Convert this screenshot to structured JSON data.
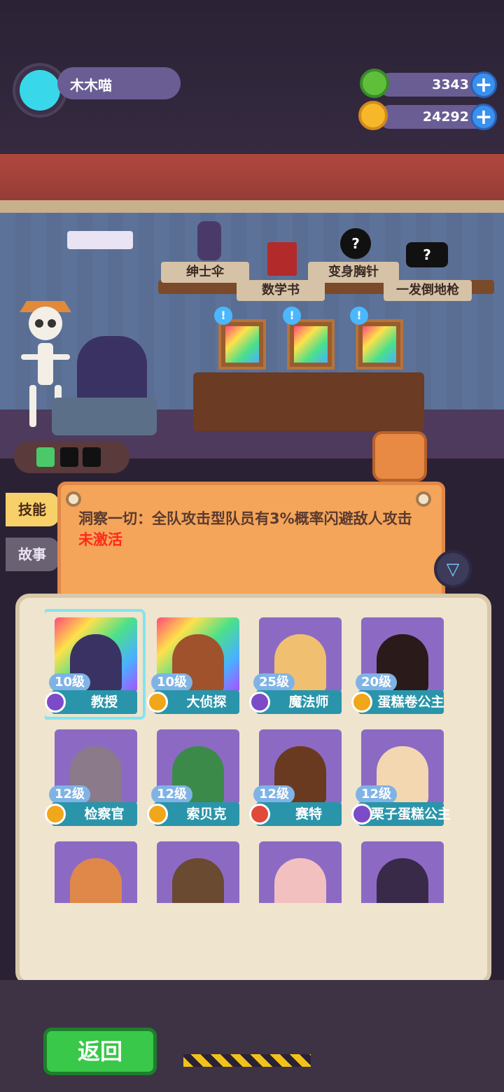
{
  "player": {
    "name": "木木喵"
  },
  "resources": {
    "gems": "3343",
    "coins": "24292"
  },
  "shelf_items": [
    {
      "label": "绅士伞"
    },
    {
      "label": "数学书"
    },
    {
      "label": "变身胸针"
    },
    {
      "label": "一发倒地枪"
    }
  ],
  "frame_alerts": [
    "!",
    "!",
    "!"
  ],
  "tabs": {
    "skills": "技能",
    "story": "故事"
  },
  "skill": {
    "description": "洞察一切：全队攻击型队员有3%概率闪避敌人攻击",
    "status": "未激活"
  },
  "characters": [
    {
      "level": "10级",
      "name": "教授",
      "badge": "purple",
      "selected": true,
      "rainbow": true,
      "face": "#3a3263"
    },
    {
      "level": "10级",
      "name": "大侦探",
      "badge": "gold",
      "selected": false,
      "rainbow": true,
      "face": "#a0522d"
    },
    {
      "level": "25级",
      "name": "魔法师",
      "badge": "purple",
      "selected": false,
      "rainbow": false,
      "face": "#f0c070"
    },
    {
      "level": "20级",
      "name": "蛋糕卷公主",
      "badge": "gold",
      "selected": false,
      "rainbow": false,
      "face": "#2a1a1a"
    },
    {
      "level": "12级",
      "name": "检察官",
      "badge": "gold",
      "selected": false,
      "rainbow": false,
      "face": "#8a7a8a"
    },
    {
      "level": "12级",
      "name": "索贝克",
      "badge": "gold",
      "selected": false,
      "rainbow": false,
      "face": "#3c8a4a"
    },
    {
      "level": "12级",
      "name": "赛特",
      "badge": "red",
      "selected": false,
      "rainbow": false,
      "face": "#6a3a20"
    },
    {
      "level": "12级",
      "name": "栗子蛋糕公主",
      "badge": "purple",
      "selected": false,
      "rainbow": false,
      "face": "#f3d7b0"
    },
    {
      "level": "",
      "name": "",
      "badge": "",
      "selected": false,
      "rainbow": false,
      "face": "#e0884a"
    },
    {
      "level": "",
      "name": "",
      "badge": "",
      "selected": false,
      "rainbow": false,
      "face": "#6a4a30"
    },
    {
      "level": "",
      "name": "",
      "badge": "",
      "selected": false,
      "rainbow": false,
      "face": "#f3c0c0"
    },
    {
      "level": "",
      "name": "",
      "badge": "",
      "selected": false,
      "rainbow": false,
      "face": "#3a2a4a"
    }
  ],
  "footer": {
    "back_label": "返回"
  },
  "colors": {
    "accent": "#39c84a",
    "status_red": "#ff2a1a",
    "tab_active": "#f7d06a"
  }
}
